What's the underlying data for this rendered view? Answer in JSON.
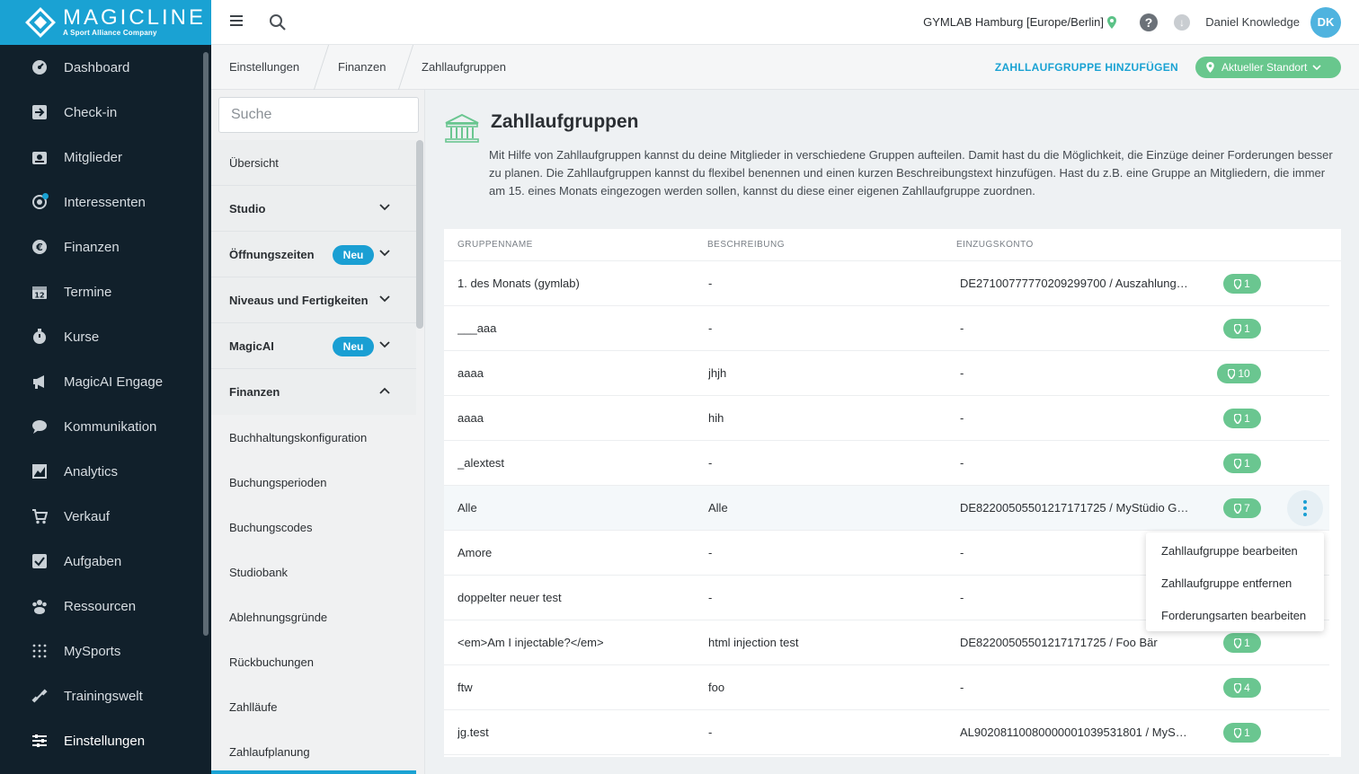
{
  "brand": {
    "name": "MAGICLINE",
    "tagline": "A Sport Alliance Company"
  },
  "nav": {
    "items": [
      {
        "label": "Dashboard",
        "icon": "dashboard-icon"
      },
      {
        "label": "Check-in",
        "icon": "checkin-icon"
      },
      {
        "label": "Mitglieder",
        "icon": "members-icon"
      },
      {
        "label": "Interessenten",
        "icon": "prospects-icon"
      },
      {
        "label": "Finanzen",
        "icon": "euro-icon"
      },
      {
        "label": "Termine",
        "icon": "calendar-icon"
      },
      {
        "label": "Kurse",
        "icon": "stopwatch-icon"
      },
      {
        "label": "MagicAI Engage",
        "icon": "megaphone-icon"
      },
      {
        "label": "Kommunikation",
        "icon": "chat-icon"
      },
      {
        "label": "Analytics",
        "icon": "chart-icon"
      },
      {
        "label": "Verkauf",
        "icon": "cart-icon"
      },
      {
        "label": "Aufgaben",
        "icon": "checkbox-icon"
      },
      {
        "label": "Ressourcen",
        "icon": "people-icon"
      },
      {
        "label": "MySports",
        "icon": "dots-grid-icon"
      },
      {
        "label": "Trainingswelt",
        "icon": "dumbbell-icon"
      },
      {
        "label": "Einstellungen",
        "icon": "sliders-icon"
      }
    ]
  },
  "topbar": {
    "studio": "GYMLAB Hamburg [Europe/Berlin]",
    "help": "?",
    "download": "↓",
    "user": "Daniel Knowledge",
    "initials": "DK"
  },
  "breadcrumb": {
    "items": [
      "Einstellungen",
      "Finanzen",
      "Zahllaufgruppen"
    ],
    "add_label": "ZAHLLAUFGRUPPE HINZUFÜGEN",
    "location_label": "Aktueller Standort"
  },
  "settings_sidebar": {
    "search_placeholder": "Suche",
    "overview": "Übersicht",
    "sections": [
      {
        "label": "Studio",
        "badge": ""
      },
      {
        "label": "Öffnungszeiten",
        "badge": "Neu"
      },
      {
        "label": "Niveaus und Fertigkeiten",
        "badge": ""
      },
      {
        "label": "MagicAI",
        "badge": "Neu"
      },
      {
        "label": "Finanzen",
        "badge": ""
      }
    ],
    "finanzen_items": [
      "Buchhaltungskonfiguration",
      "Buchungsperioden",
      "Buchungscodes",
      "Studiobank",
      "Ablehnungsgründe",
      "Rückbuchungen",
      "Zahlläufe",
      "Zahlaufplanung"
    ]
  },
  "page": {
    "title": "Zahllaufgruppen",
    "description": "Mit Hilfe von Zahllaufgruppen kannst du deine Mitglieder in verschiedene Gruppen aufteilen. Damit hast du die Möglichkeit, die Einzüge deiner Forderungen besser zu planen. Die Zahllaufgruppen kannst du flexibel benennen und einen kurzen Beschreibungstext hinzufügen. Hast du z.B. eine Gruppe an Mitgliedern, die immer am 15. eines Monats eingezogen werden sollen, kannst du diese einer eigenen Zahllaufgruppe zuordnen."
  },
  "table": {
    "columns": [
      "GRUPPENNAME",
      "BESCHREIBUNG",
      "EINZUGSKONTO"
    ],
    "rows": [
      {
        "name": "1. des Monats (gymlab)",
        "desc": "-",
        "account": "DE27100777770209299700 / Auszahlung…",
        "locations": "1"
      },
      {
        "name": "___aaa",
        "desc": "-",
        "account": "-",
        "locations": "1"
      },
      {
        "name": "aaaa",
        "desc": "jhjh",
        "account": "-",
        "locations": "10"
      },
      {
        "name": "aaaa",
        "desc": "hih",
        "account": "-",
        "locations": "1"
      },
      {
        "name": "_alextest",
        "desc": "-",
        "account": "-",
        "locations": "1"
      },
      {
        "name": "Alle",
        "desc": "Alle",
        "account": "DE82200505501217171725 / MyStüdio G…",
        "locations": "7"
      },
      {
        "name": "Amore",
        "desc": "-",
        "account": "-",
        "locations": ""
      },
      {
        "name": "doppelter neuer test",
        "desc": "-",
        "account": "-",
        "locations": ""
      },
      {
        "name": "<em>Am I injectable?</em>",
        "desc": "html injection test",
        "account": "DE82200505501217171725 / Foo Bär",
        "locations": "1"
      },
      {
        "name": "ftw",
        "desc": "foo",
        "account": "-",
        "locations": "4"
      },
      {
        "name": "jg.test",
        "desc": "-",
        "account": "AL90208110080000001039531801 / MySt…",
        "locations": "1"
      }
    ]
  },
  "context_menu": {
    "items": [
      "Zahllaufgruppe bearbeiten",
      "Zahllaufgruppe entfernen",
      "Forderungsarten bearbeiten"
    ]
  },
  "colors": {
    "brand": "#1aa2d3",
    "nav_bg": "#11202b",
    "pill_green": "#6ac690"
  }
}
